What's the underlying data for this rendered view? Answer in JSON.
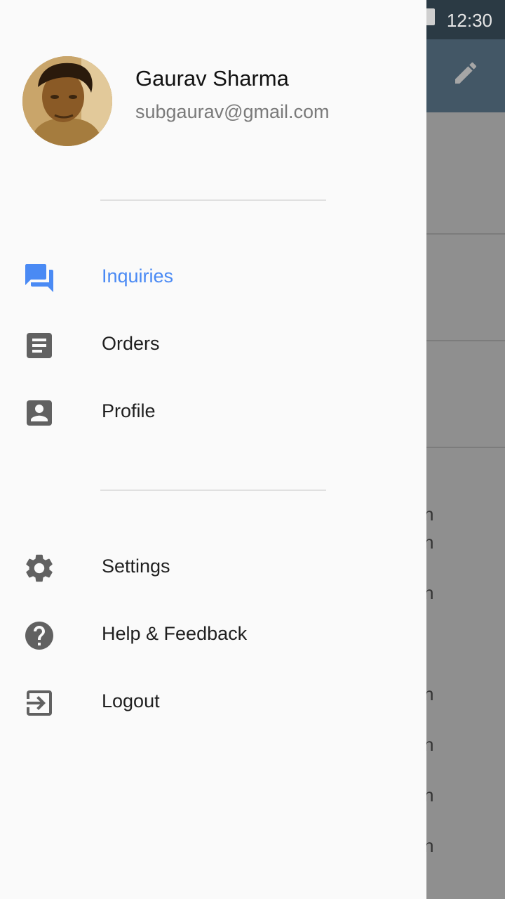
{
  "status_bar": {
    "time": "12:30"
  },
  "user": {
    "name": "Gaurav Sharma",
    "email": "subgaurav@gmail.com"
  },
  "nav": {
    "primary": [
      {
        "label": "Inquiries",
        "icon": "forum-icon",
        "active": true
      },
      {
        "label": "Orders",
        "icon": "description-icon",
        "active": false
      },
      {
        "label": "Profile",
        "icon": "account-box-icon",
        "active": false
      }
    ],
    "secondary": [
      {
        "label": "Settings",
        "icon": "gear-icon"
      },
      {
        "label": "Help & Feedback",
        "icon": "help-icon"
      },
      {
        "label": "Logout",
        "icon": "logout-icon"
      }
    ]
  },
  "background": {
    "visible_glyphs": [
      "n",
      "n",
      "n",
      "n",
      "n",
      "n",
      "n"
    ]
  },
  "colors": {
    "accent": "#4a8af4",
    "icon_gray": "#616161",
    "app_bar": "#435766"
  }
}
